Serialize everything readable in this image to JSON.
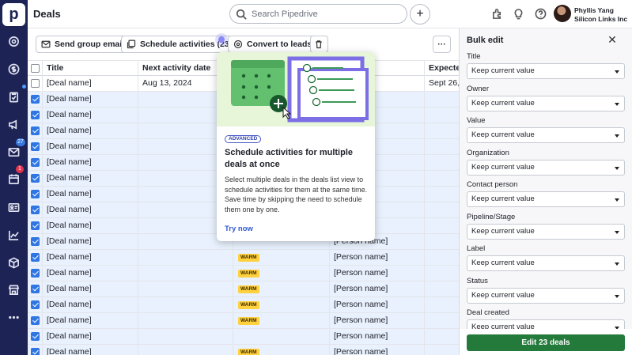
{
  "app": {
    "logo_letter": "p"
  },
  "rail": {
    "items": [
      {
        "icon": "target-icon"
      },
      {
        "icon": "dollar-icon"
      },
      {
        "icon": "clipboard-icon"
      },
      {
        "icon": "megaphone-icon"
      },
      {
        "icon": "mail-icon",
        "badge": "27"
      },
      {
        "icon": "calendar-icon",
        "badge": "1"
      },
      {
        "icon": "contacts-icon"
      },
      {
        "icon": "chart-icon"
      },
      {
        "icon": "box-icon"
      },
      {
        "icon": "store-icon"
      },
      {
        "icon": "more-icon"
      }
    ]
  },
  "header": {
    "title": "Deals",
    "search_placeholder": "Search Pipedrive",
    "user_name": "Phyllis Yang",
    "user_company": "Silicon Links Inc"
  },
  "toolbar": {
    "send_email": "Send group email",
    "schedule": "Schedule activities (23)",
    "convert": "Convert to leads",
    "more": "···"
  },
  "table": {
    "columns": [
      "Title",
      "Next activity date",
      "",
      "son",
      "Expected"
    ],
    "rows": [
      {
        "selected": false,
        "title": "[Deal name]",
        "date": "Aug 13, 2024",
        "label": "",
        "person": "",
        "expected": "Sept 26,"
      },
      {
        "selected": true,
        "title": "[Deal name]",
        "date": "",
        "label": "",
        "person": "",
        "expected": ""
      },
      {
        "selected": true,
        "title": "[Deal name]",
        "date": "",
        "label": "",
        "person": "",
        "expected": ""
      },
      {
        "selected": true,
        "title": "[Deal name]",
        "date": "",
        "label": "",
        "person": "",
        "expected": ""
      },
      {
        "selected": true,
        "title": "[Deal name]",
        "date": "",
        "label": "",
        "person": "",
        "expected": ""
      },
      {
        "selected": true,
        "title": "[Deal name]",
        "date": "",
        "label": "",
        "person": "",
        "expected": ""
      },
      {
        "selected": true,
        "title": "[Deal name]",
        "date": "",
        "label": "",
        "person": "",
        "expected": ""
      },
      {
        "selected": true,
        "title": "[Deal name]",
        "date": "",
        "label": "",
        "person": "",
        "expected": ""
      },
      {
        "selected": true,
        "title": "[Deal name]",
        "date": "",
        "label": "",
        "person": "",
        "expected": ""
      },
      {
        "selected": true,
        "title": "[Deal name]",
        "date": "",
        "label": "",
        "person": "",
        "expected": ""
      },
      {
        "selected": true,
        "title": "[Deal name]",
        "date": "",
        "label": "",
        "person": "[Person name]",
        "expected": ""
      },
      {
        "selected": true,
        "title": "[Deal name]",
        "date": "",
        "label": "WARM",
        "person": "[Person name]",
        "expected": ""
      },
      {
        "selected": true,
        "title": "[Deal name]",
        "date": "",
        "label": "WARM",
        "person": "[Person name]",
        "expected": ""
      },
      {
        "selected": true,
        "title": "[Deal name]",
        "date": "",
        "label": "WARM",
        "person": "[Person name]",
        "expected": ""
      },
      {
        "selected": true,
        "title": "[Deal name]",
        "date": "",
        "label": "WARM",
        "person": "[Person name]",
        "expected": ""
      },
      {
        "selected": true,
        "title": "[Deal name]",
        "date": "",
        "label": "WARM",
        "person": "[Person name]",
        "expected": ""
      },
      {
        "selected": true,
        "title": "[Deal name]",
        "date": "",
        "label": "",
        "person": "[Person name]",
        "expected": ""
      },
      {
        "selected": true,
        "title": "[Deal name]",
        "date": "",
        "label": "WARM",
        "person": "[Person name]",
        "expected": ""
      }
    ]
  },
  "popover": {
    "badge": "ADVANCED",
    "title": "Schedule activities for multiple deals at once",
    "body": "Select multiple deals in the deals list view to schedule activities for them at the same time. Save time by skipping the need to schedule them one by one.",
    "link": "Try now"
  },
  "bulk_edit": {
    "title": "Bulk edit",
    "fields": [
      {
        "label": "Title",
        "value": "Keep current value"
      },
      {
        "label": "Owner",
        "value": "Keep current value"
      },
      {
        "label": "Value",
        "value": "Keep current value"
      },
      {
        "label": "Organization",
        "value": "Keep current value"
      },
      {
        "label": "Contact person",
        "value": "Keep current value"
      },
      {
        "label": "Pipeline/Stage",
        "value": "Keep current value"
      },
      {
        "label": "Label",
        "value": "Keep current value"
      },
      {
        "label": "Status",
        "value": "Keep current value"
      },
      {
        "label": "Deal created",
        "value": "Keep current value"
      }
    ],
    "submit": "Edit 23 deals"
  },
  "colors": {
    "rail": "#1d2355",
    "selected_row": "#e8f1fd",
    "checkbox": "#2f76e3",
    "warm_label": "#ffd13f",
    "primary_button": "#237a3b",
    "popover_illustration": "#e7f6d8"
  }
}
